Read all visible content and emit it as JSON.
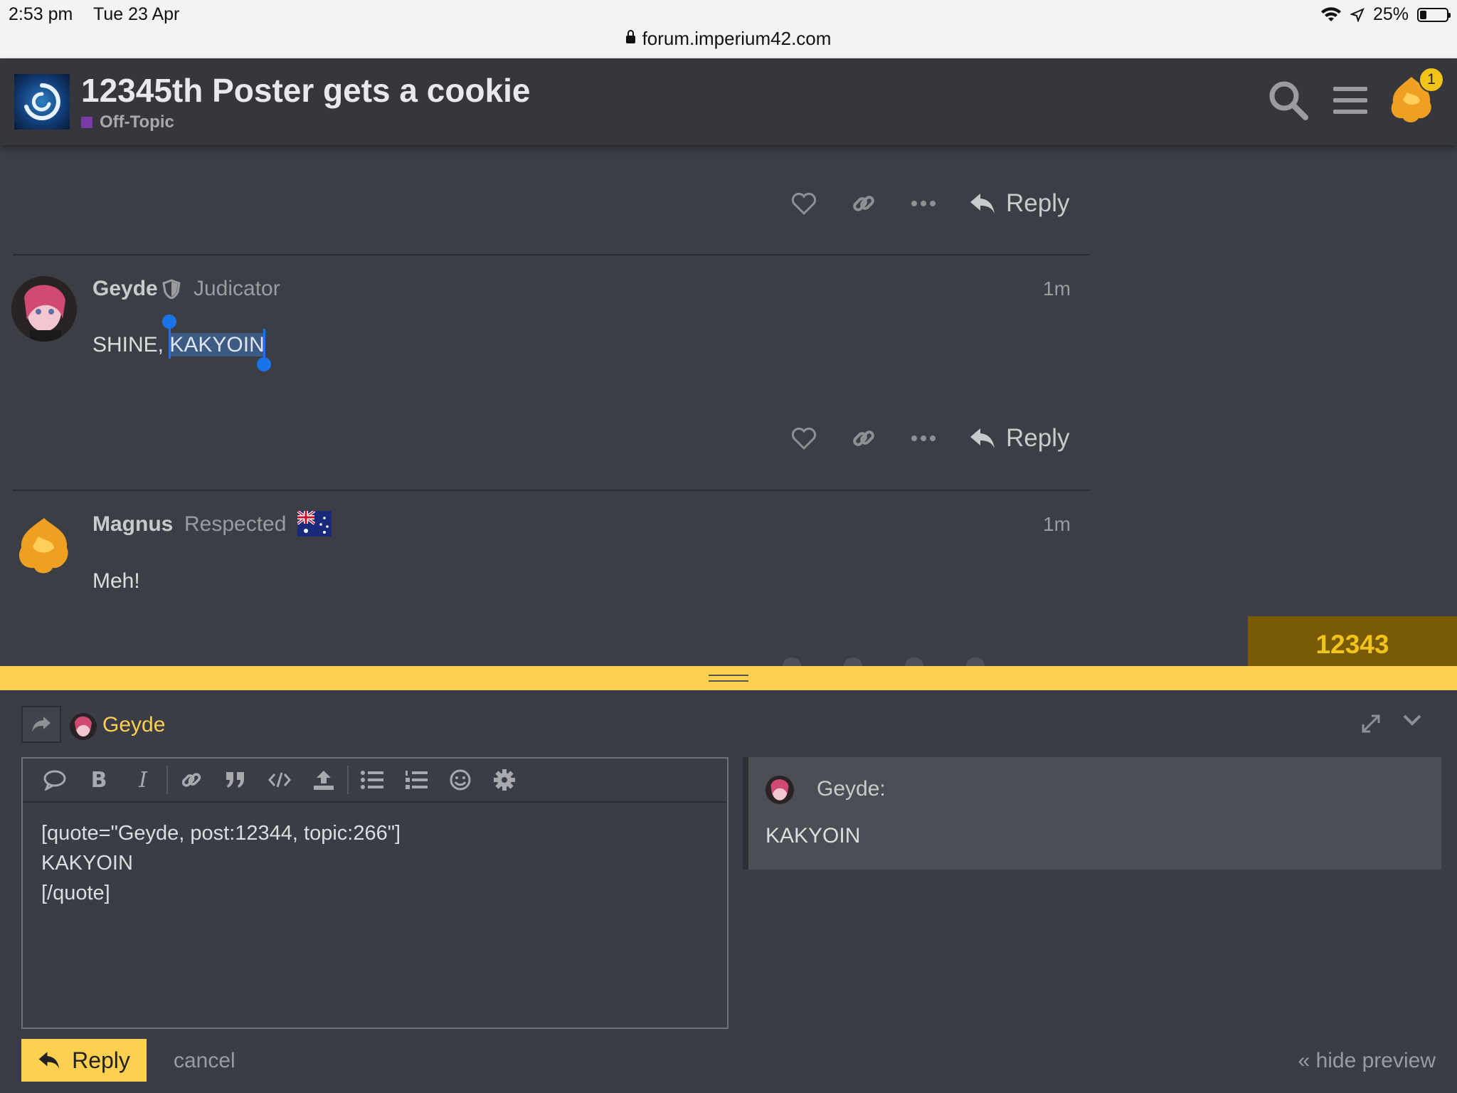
{
  "status_bar": {
    "time": "2:53 pm",
    "date": "Tue 23 Apr",
    "url": "forum.imperium42.com",
    "battery": "25%",
    "battery_level": 0.25
  },
  "header": {
    "title": "12345th Poster gets a cookie",
    "category": "Off-Topic",
    "category_color": "#7a3aa8",
    "notification_count": "1"
  },
  "posts": [
    {
      "username": "Geyde",
      "user_title": "Judicator",
      "time": "1m",
      "body_before": "SHINE, ",
      "body_selected": "KAKYOIN"
    },
    {
      "username": "Magnus",
      "user_title": "Respected",
      "time": "1m",
      "body": "Meh!"
    }
  ],
  "actions": {
    "reply_label": "Reply"
  },
  "timeline": {
    "post_number": "12343"
  },
  "composer": {
    "reply_to": "Geyde",
    "editor_text": "[quote=\"Geyde, post:12344, topic:266\"]\nKAKYOIN\n[/quote]",
    "preview_name": "Geyde:",
    "preview_text": "KAKYOIN",
    "reply_button": "Reply",
    "cancel": "cancel",
    "hide_preview": "« hide preview"
  },
  "colors": {
    "accent": "#fdd04f",
    "background": "#3b3e45",
    "selection": "#1a73e8"
  }
}
